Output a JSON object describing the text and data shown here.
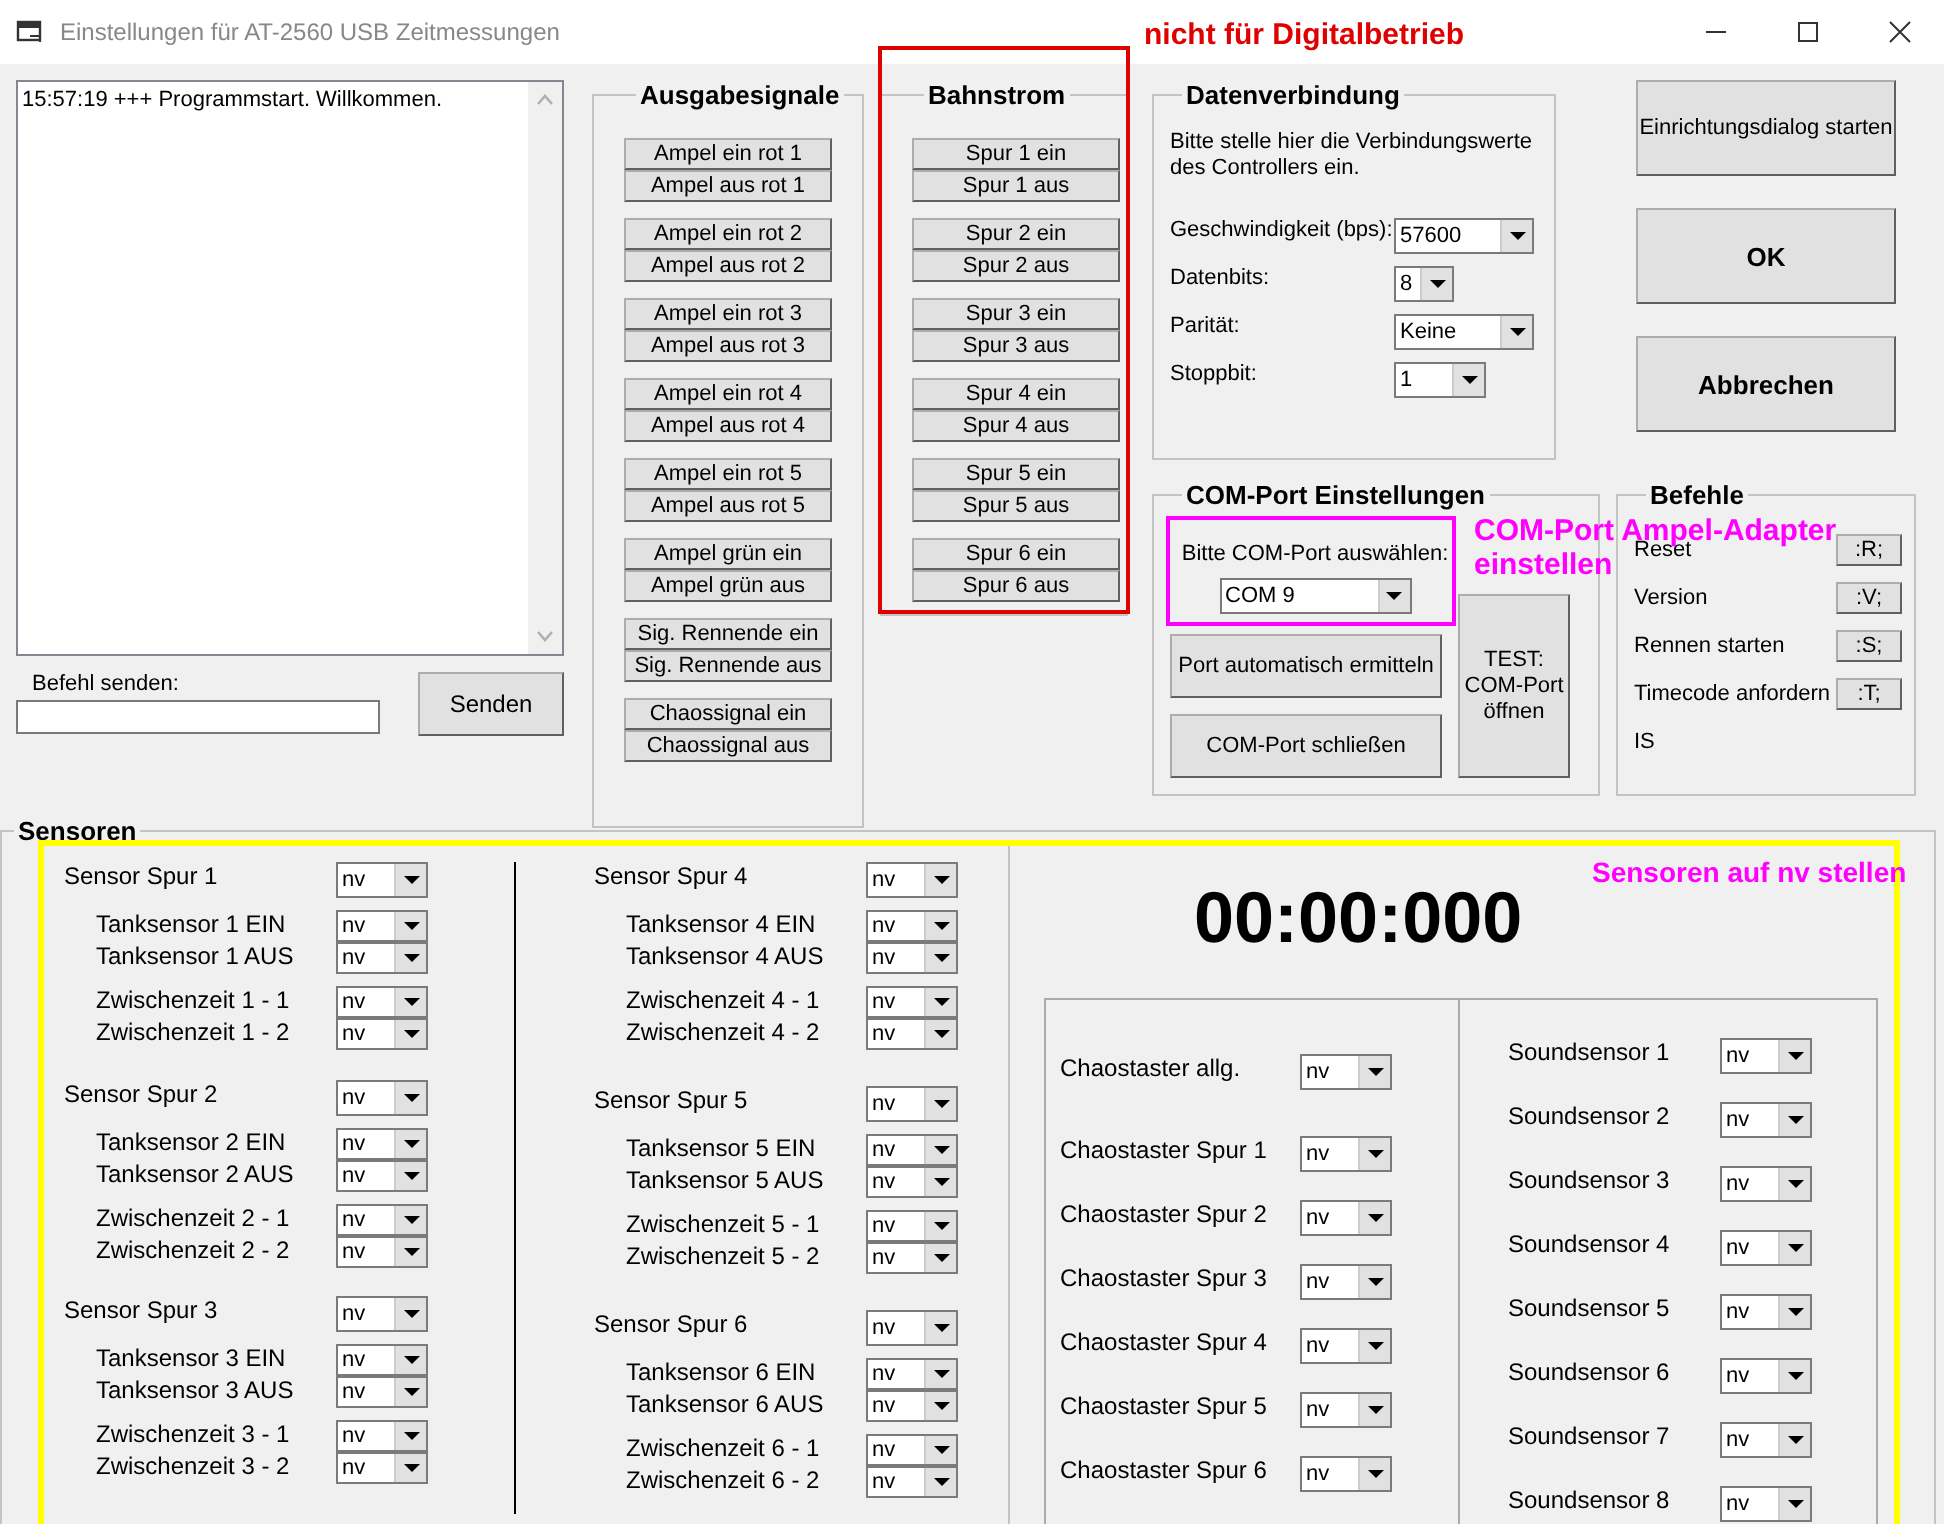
{
  "window": {
    "title": "Einstellungen für AT-2560 USB Zeitmessungen"
  },
  "log": {
    "lines": [
      "15:57:19 +++ Programmstart. Willkommen."
    ]
  },
  "command": {
    "label": "Befehl senden:",
    "button": "Senden"
  },
  "ausgabesignale": {
    "title": "Ausgabesignale",
    "groups": [
      [
        "Ampel ein rot 1",
        "Ampel aus rot 1"
      ],
      [
        "Ampel ein rot 2",
        "Ampel aus rot 2"
      ],
      [
        "Ampel ein rot 3",
        "Ampel aus rot 3"
      ],
      [
        "Ampel ein rot 4",
        "Ampel aus rot 4"
      ],
      [
        "Ampel ein rot 5",
        "Ampel aus rot 5"
      ],
      [
        "Ampel grün ein",
        "Ampel grün aus"
      ],
      [
        "Sig. Rennende ein",
        "Sig. Rennende aus"
      ],
      [
        "Chaossignal ein",
        "Chaossignal aus"
      ]
    ]
  },
  "bahnstrom": {
    "title": "Bahnstrom",
    "groups": [
      [
        "Spur 1 ein",
        "Spur 1 aus"
      ],
      [
        "Spur 2 ein",
        "Spur 2 aus"
      ],
      [
        "Spur 3 ein",
        "Spur 3 aus"
      ],
      [
        "Spur 4 ein",
        "Spur 4 aus"
      ],
      [
        "Spur 5 ein",
        "Spur 5 aus"
      ],
      [
        "Spur 6 ein",
        "Spur 6 aus"
      ]
    ]
  },
  "datenverbindung": {
    "title": "Datenverbindung",
    "hint": "Bitte stelle hier die Verbindungswerte des Controllers ein.",
    "fields": [
      {
        "label": "Geschwindigkeit (bps):",
        "value": "57600",
        "kind": "wide"
      },
      {
        "label": "Datenbits:",
        "value": "8",
        "kind": "narrow"
      },
      {
        "label": "Parität:",
        "value": "Keine",
        "kind": "wide"
      },
      {
        "label": "Stoppbit:",
        "value": "1",
        "kind": "medium"
      }
    ]
  },
  "dialog_buttons": [
    {
      "label": "Einrichtungsdialog starten",
      "kind": "normal"
    },
    {
      "label": "OK",
      "kind": "bold"
    },
    {
      "label": "Abbrechen",
      "kind": "bold"
    }
  ],
  "com_port": {
    "title": "COM-Port Einstellungen",
    "prompt": "Bitte COM-Port auswählen:",
    "value": "COM 9",
    "buttons": [
      "Port automatisch ermitteln",
      "COM-Port schließen"
    ],
    "test_button": "TEST:\nCOM-Port\nöffnen"
  },
  "befehle": {
    "title": "Befehle",
    "commands": [
      {
        "label": "Reset",
        "code": ":R;"
      },
      {
        "label": "Version",
        "code": ":V;"
      },
      {
        "label": "Rennen starten",
        "code": ":S;"
      },
      {
        "label": "Timecode anfordern",
        "code": ":T;"
      }
    ],
    "status": "IS"
  },
  "sensoren": {
    "title": "Sensoren",
    "timer": "00:00:000",
    "tracks": [
      {
        "label": "Sensor Spur 1",
        "value": "nv",
        "tank": [
          {
            "label": "Tanksensor 1 EIN",
            "value": "nv"
          },
          {
            "label": "Tanksensor 1 AUS",
            "value": "nv"
          }
        ],
        "split": [
          {
            "label": "Zwischenzeit 1 - 1",
            "value": "nv"
          },
          {
            "label": "Zwischenzeit 1 - 2",
            "value": "nv"
          }
        ]
      },
      {
        "label": "Sensor Spur 2",
        "value": "nv",
        "tank": [
          {
            "label": "Tanksensor 2 EIN",
            "value": "nv"
          },
          {
            "label": "Tanksensor 2 AUS",
            "value": "nv"
          }
        ],
        "split": [
          {
            "label": "Zwischenzeit 2 - 1",
            "value": "nv"
          },
          {
            "label": "Zwischenzeit 2 - 2",
            "value": "nv"
          }
        ]
      },
      {
        "label": "Sensor Spur 3",
        "value": "nv",
        "tank": [
          {
            "label": "Tanksensor 3 EIN",
            "value": "nv"
          },
          {
            "label": "Tanksensor 3 AUS",
            "value": "nv"
          }
        ],
        "split": [
          {
            "label": "Zwischenzeit 3 - 1",
            "value": "nv"
          },
          {
            "label": "Zwischenzeit 3 - 2",
            "value": "nv"
          }
        ]
      },
      {
        "label": "Sensor Spur 4",
        "value": "nv",
        "tank": [
          {
            "label": "Tanksensor 4 EIN",
            "value": "nv"
          },
          {
            "label": "Tanksensor 4 AUS",
            "value": "nv"
          }
        ],
        "split": [
          {
            "label": "Zwischenzeit 4 - 1",
            "value": "nv"
          },
          {
            "label": "Zwischenzeit 4 - 2",
            "value": "nv"
          }
        ]
      },
      {
        "label": "Sensor Spur 5",
        "value": "nv",
        "tank": [
          {
            "label": "Tanksensor 5 EIN",
            "value": "nv"
          },
          {
            "label": "Tanksensor 5 AUS",
            "value": "nv"
          }
        ],
        "split": [
          {
            "label": "Zwischenzeit 5 - 1",
            "value": "nv"
          },
          {
            "label": "Zwischenzeit 5 - 2",
            "value": "nv"
          }
        ]
      },
      {
        "label": "Sensor Spur 6",
        "value": "nv",
        "tank": [
          {
            "label": "Tanksensor 6 EIN",
            "value": "nv"
          },
          {
            "label": "Tanksensor 6 AUS",
            "value": "nv"
          }
        ],
        "split": [
          {
            "label": "Zwischenzeit 6 - 1",
            "value": "nv"
          },
          {
            "label": "Zwischenzeit 6 - 2",
            "value": "nv"
          }
        ]
      }
    ],
    "chaos": [
      {
        "label": "Chaostaster allg.",
        "value": "nv"
      },
      {
        "label": "Chaostaster Spur 1",
        "value": "nv"
      },
      {
        "label": "Chaostaster Spur 2",
        "value": "nv"
      },
      {
        "label": "Chaostaster Spur 3",
        "value": "nv"
      },
      {
        "label": "Chaostaster Spur 4",
        "value": "nv"
      },
      {
        "label": "Chaostaster Spur 5",
        "value": "nv"
      },
      {
        "label": "Chaostaster Spur 6",
        "value": "nv"
      }
    ],
    "sound": [
      {
        "label": "Soundsensor 1",
        "value": "nv"
      },
      {
        "label": "Soundsensor 2",
        "value": "nv"
      },
      {
        "label": "Soundsensor 3",
        "value": "nv"
      },
      {
        "label": "Soundsensor 4",
        "value": "nv"
      },
      {
        "label": "Soundsensor 5",
        "value": "nv"
      },
      {
        "label": "Soundsensor 6",
        "value": "nv"
      },
      {
        "label": "Soundsensor 7",
        "value": "nv"
      },
      {
        "label": "Soundsensor 8",
        "value": "nv"
      }
    ]
  },
  "annotations": {
    "digital_note": "nicht für Digitalbetrieb",
    "com_note": [
      "COM-Port Ampel-Adapter",
      "einstellen"
    ],
    "sensor_note": "Sensoren auf nv stellen"
  }
}
